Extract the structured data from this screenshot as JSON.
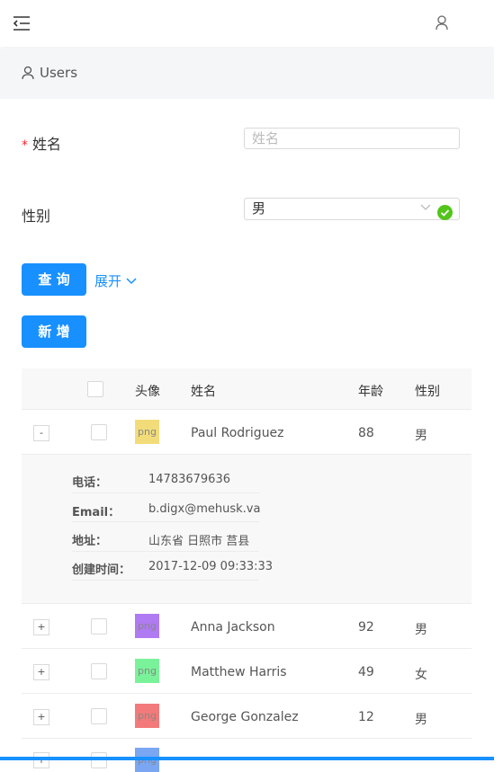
{
  "breadcrumb": {
    "label": "Users"
  },
  "form": {
    "name_label": "姓名",
    "required_mark": "*",
    "name_placeholder": "姓名",
    "gender_label": "性别",
    "gender_value": "男",
    "query_button": "查 询",
    "expand_link": "展开",
    "add_button": "新 增"
  },
  "table": {
    "headers": {
      "avatar": "头像",
      "name": "姓名",
      "age": "年龄",
      "gender": "性别"
    },
    "rows": [
      {
        "expand": "-",
        "avatar": "png",
        "avatar_color": "#f2dc7a",
        "name": "Paul Rodriguez",
        "age": "88",
        "gender": "男"
      },
      {
        "expand": "+",
        "avatar": "png",
        "avatar_color": "#b07af2",
        "name": "Anna Jackson",
        "age": "92",
        "gender": "男"
      },
      {
        "expand": "+",
        "avatar": "png",
        "avatar_color": "#7af29a",
        "name": "Matthew Harris",
        "age": "49",
        "gender": "女"
      },
      {
        "expand": "+",
        "avatar": "png",
        "avatar_color": "#f27a7a",
        "name": "George Gonzalez",
        "age": "12",
        "gender": "男"
      },
      {
        "expand": "+",
        "avatar": "png",
        "avatar_color": "#7aa6f2",
        "name": "",
        "age": "",
        "gender": ""
      }
    ],
    "detail": {
      "phone_label": "电话：",
      "phone": "14783679636",
      "email_label": "Email：",
      "email": "b.digx@mehusk.va",
      "address_label": "地址：",
      "address": "山东省 日照市 莒县",
      "created_label": "创建时间：",
      "created": "2017-12-09 09:33:33"
    }
  },
  "colors": {
    "primary": "#1890ff",
    "success": "#52c41a",
    "required": "#f5222d"
  }
}
